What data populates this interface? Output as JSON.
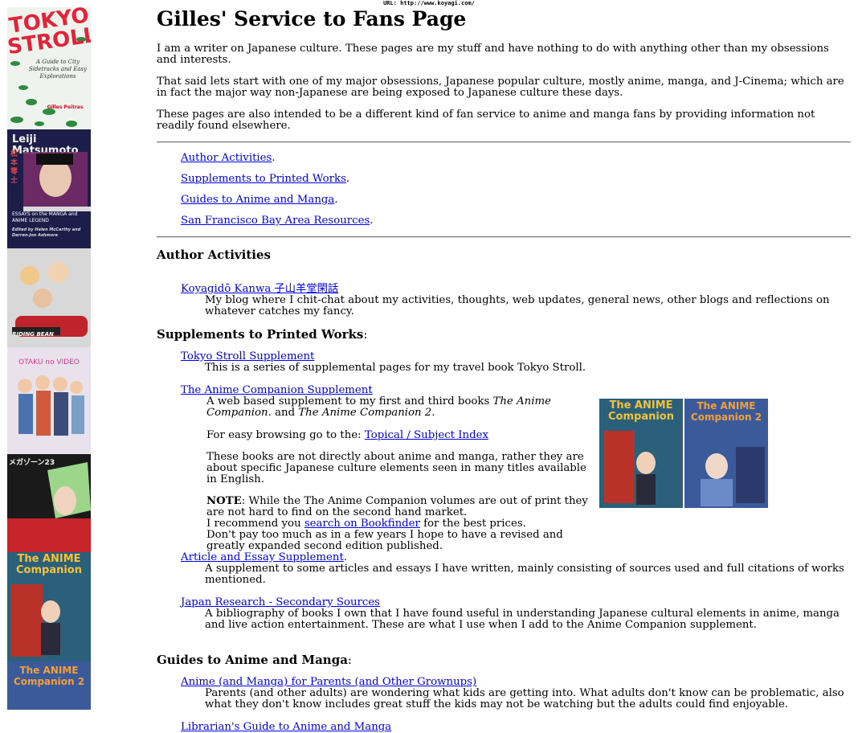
{
  "url_bar": "URL: http://www.koyagi.com/",
  "sidebar": {
    "covers": [
      {
        "title_line1": "TOKYO",
        "title_line2": "STROLL",
        "sub": "A Guide to City Sidetracks and Easy Explorations",
        "author": "Gilles Poitras"
      },
      {
        "title": "Leiji Matsumoto",
        "jp": "松本零士",
        "sub": "ESSAYS on the MANGA and ANIME LEGEND",
        "eds": "Edited by Helen McCarthy and Darren-Jon Ashmore"
      },
      {
        "title": "RIDING BEAN"
      },
      {
        "title": "OTAKU no VIDEO"
      },
      {
        "title": "メガゾーン23"
      },
      {
        "title": "The ANIME Companion"
      },
      {
        "title": "The ANIME Companion 2"
      }
    ]
  },
  "page": {
    "title": "Gilles' Service to Fans Page",
    "intro1": "I am a writer on Japanese culture. These pages are my stuff and have nothing to do with anything other than my obsessions and interests.",
    "intro2": "That said lets start with one of my major obsessions, Japanese popular culture, mostly anime, manga, and J-Cinema; which are in fact the major way non-Japanese are being exposed to Japanese culture these days.",
    "intro3": "These pages are also intended to be a different kind of fan service to anime and manga fans by providing information not readily found elsewhere."
  },
  "toc": [
    {
      "label": "Author Activities",
      "suffix": "."
    },
    {
      "label": "Supplements to Printed Works",
      "suffix": "."
    },
    {
      "label": "Guides to Anime and Manga",
      "suffix": "."
    },
    {
      "label": "San Francisco Bay Area Resources",
      "suffix": "."
    }
  ],
  "author": {
    "heading": "Author Activities",
    "blog_link": "Koyagidō Kanwa 子山羊堂閑話",
    "blog_desc": "My blog where I chit-chat about my activities, thoughts, web updates, general news, other blogs and reflections on whatever catches my fancy."
  },
  "supplements": {
    "heading": "Supplements to Printed Works",
    "colon": ":",
    "tokyo_link": "Tokyo Stroll Supplement",
    "tokyo_desc": "This is a series of supplemental pages for my travel book Tokyo Stroll.",
    "companion_link": "The Anime Companion Supplement",
    "companion_desc_a": "A web based supplement to my first and third books ",
    "companion_book1": "The Anime Companion",
    "companion_desc_b": ". and ",
    "companion_book2": "The Anime Companion 2",
    "companion_desc_c": ".",
    "browse_prefix": "For easy browsing go to the: ",
    "browse_link": "Topical / Subject Index",
    "not_about": "These books are not directly about anime and manga, rather they are about specific Japanese culture elements seen in many titles available in English.",
    "note_label": "NOTE",
    "note_text": ": While the The Anime Companion volumes are out of print they are not hard to find on the second hand market.",
    "recommend_prefix": "I recommend you ",
    "recommend_link": "search on Bookfinder",
    "recommend_suffix": " for the best prices.",
    "dont_pay": "Don't pay too much as in a few years I hope to have a revised and greatly expanded second edition published.",
    "article_link": "Article and Essay Supplement",
    "article_suffix": ".",
    "article_desc": "A supplement to some articles and essays I have written, mainly consisting of sources used and full citations of works mentioned.",
    "research_link": "Japan Research - Secondary Sources",
    "research_desc": "A bibliography of books I own that I have found useful in understanding Japanese cultural elements in anime, manga and live action entertainment. These are what I use when I add to the Anime Companion supplement.",
    "inline_cover1": "The ANIME Companion",
    "inline_cover2": "The ANIME Companion 2"
  },
  "guides": {
    "heading": "Guides to Anime and Manga",
    "colon": ":",
    "parents_link": "Anime (and Manga) for Parents (and Other Grownups)",
    "parents_desc": "Parents (and other adults) are wondering what kids are getting into. What adults don't know can be problematic, also what they don't know includes great stuff the kids may not be watching but the adults could find enjoyable.",
    "librarian_link": "Librarian's Guide to Anime and Manga"
  }
}
